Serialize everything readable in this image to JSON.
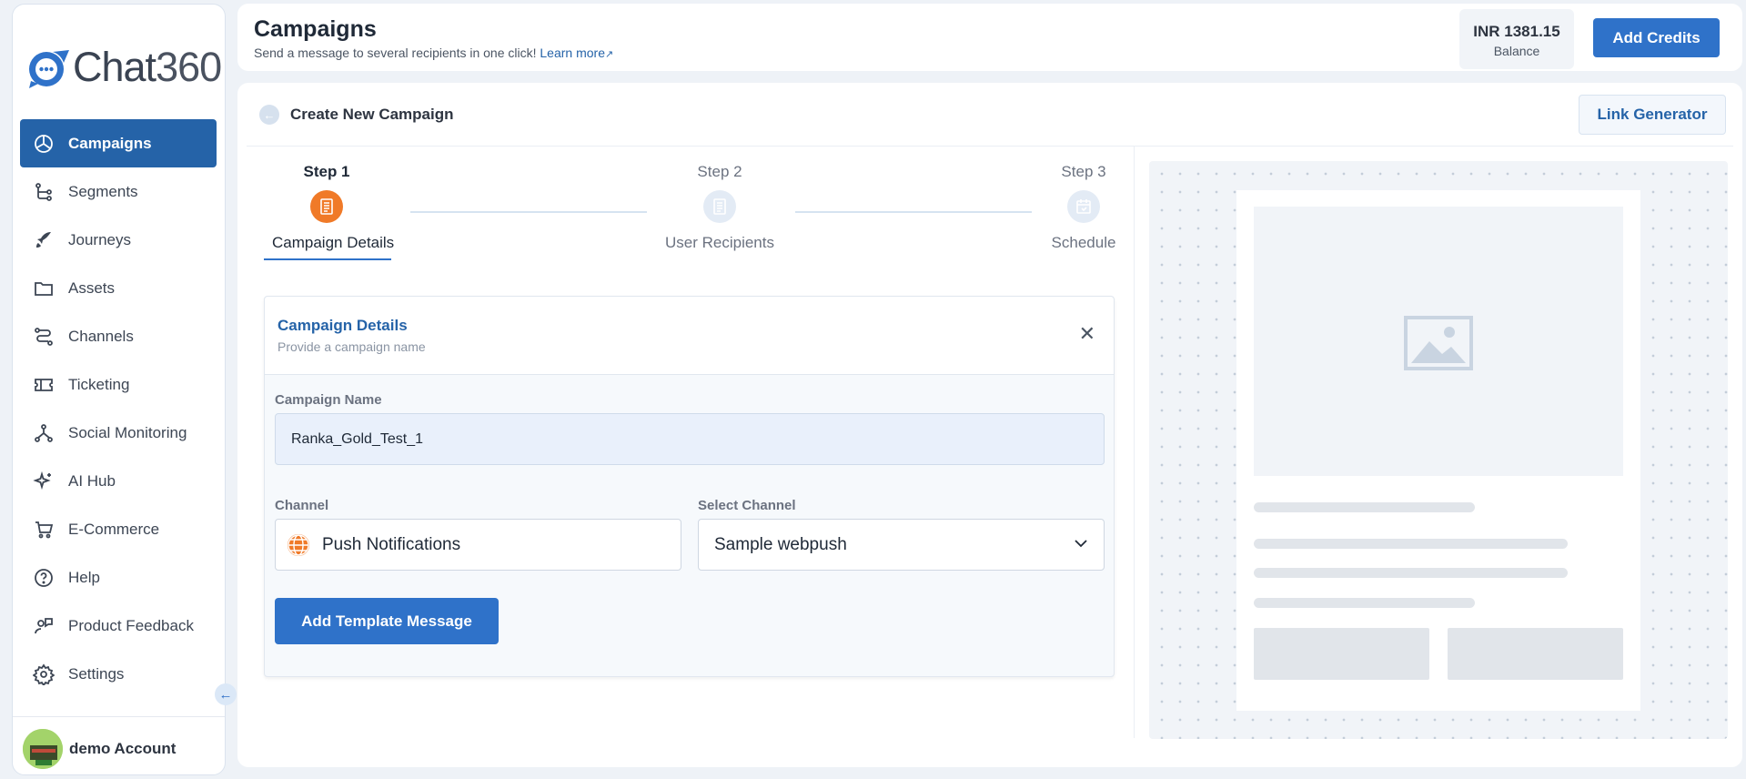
{
  "brand": {
    "logo_text": "Chat",
    "logo_num": "360"
  },
  "sidebar": {
    "items": [
      {
        "label": "Campaigns",
        "icon": "pie-chart-icon",
        "active": true
      },
      {
        "label": "Segments",
        "icon": "segments-icon"
      },
      {
        "label": "Journeys",
        "icon": "rocket-icon"
      },
      {
        "label": "Assets",
        "icon": "folder-icon"
      },
      {
        "label": "Channels",
        "icon": "channels-icon"
      },
      {
        "label": "Ticketing",
        "icon": "ticket-icon"
      },
      {
        "label": "Social Monitoring",
        "icon": "network-icon"
      },
      {
        "label": "AI Hub",
        "icon": "sparkle-icon"
      },
      {
        "label": "E-Commerce",
        "icon": "cart-icon"
      },
      {
        "label": "Help",
        "icon": "help-icon"
      },
      {
        "label": "Product Feedback",
        "icon": "feedback-icon"
      },
      {
        "label": "Settings",
        "icon": "gear-icon"
      }
    ],
    "account_name": "demo Account"
  },
  "header": {
    "title": "Campaigns",
    "subtitle": "Send a message to several recipients in one click!",
    "learn_more": "Learn more",
    "balance_value": "INR 1381.15",
    "balance_label": "Balance",
    "add_credits_label": "Add Credits"
  },
  "main": {
    "title": "Create New Campaign",
    "link_generator_label": "Link Generator",
    "steps": [
      {
        "step": "Step 1",
        "name": "Campaign Details",
        "state": "active"
      },
      {
        "step": "Step 2",
        "name": "User Recipients",
        "state": "pending"
      },
      {
        "step": "Step 3",
        "name": "Schedule",
        "state": "pending"
      }
    ],
    "card": {
      "title": "Campaign Details",
      "subtitle": "Provide a campaign name",
      "campaign_name_label": "Campaign Name",
      "campaign_name_value": "Ranka_Gold_Test_1",
      "channel_label": "Channel",
      "channel_value": "Push Notifications",
      "select_channel_label": "Select Channel",
      "select_channel_value": "Sample webpush",
      "add_template_label": "Add Template Message"
    }
  },
  "colors": {
    "primary": "#2f72c9",
    "accent_orange": "#f07a28",
    "active_nav": "#2563a8"
  }
}
